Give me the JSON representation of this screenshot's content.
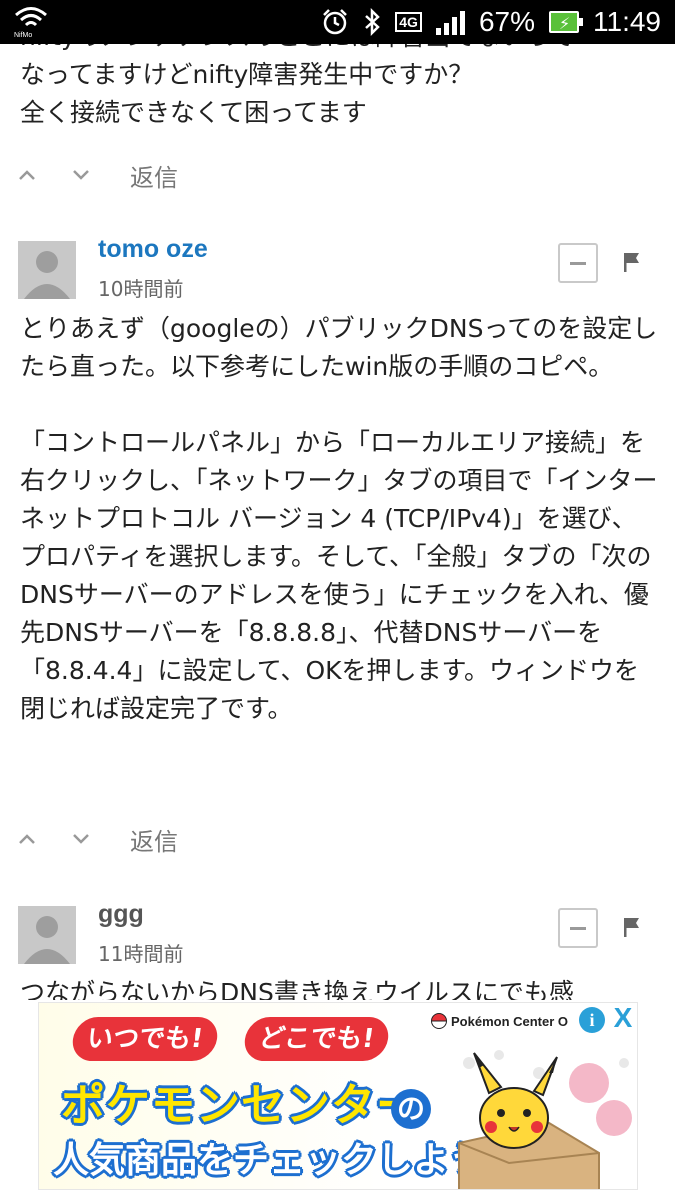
{
  "status_bar": {
    "carrier_logo": "NifMo",
    "icons": [
      "wifi-icon",
      "alarm-icon",
      "bluetooth-icon",
      "4g-icon",
      "signal-icon",
      "battery-charging-icon"
    ],
    "network": "4G",
    "battery": "67%",
    "time": "11:49"
  },
  "thread": {
    "prev_comment": {
      "lines": [
        "niftyのメンテナンスのとこには障害出てないって",
        "なってますけどnifty障害発生中ですか？",
        "全く接続できなくて困ってます"
      ],
      "reply_label": "返信"
    },
    "comments": [
      {
        "author": "tomo oze",
        "time": "10時間前",
        "paragraphs": [
          "とりあえず（googleの）パブリックDNSってのを設定したら直った。以下参考にしたwin版の手順のコピペ。",
          "「コントロールパネル」から「ローカルエリア接続」を右クリックし、「ネットワーク」タブの項目で「インターネットプロトコル バージョン 4 (TCP/IPv4)」を選び、プロパティを選択します。そして、「全般」タブの「次のDNSサーバーのアドレスを使う」にチェックを入れ、優先DNSサーバーを「8.8.8.8」、代替DNSサーバーを「8.8.4.4」に設定して、OKを押します。ウィンドウを閉じれば設定完了です。"
        ],
        "reply_label": "返信"
      },
      {
        "author": "ggg",
        "time": "11時間前",
        "paragraphs": [
          "つながらないからDNS書き換えウイルスにでも感"
        ]
      }
    ]
  },
  "ad": {
    "badge_1": "いつでも!",
    "badge_2": "どこでも!",
    "brand": "Pokémon Center O",
    "title": "ポケモンセンター",
    "connector": "の",
    "subtitle": "人気商品をチェックしよう!",
    "info_label": "i",
    "close_label": "X",
    "colors": {
      "title_fill": "#ffe600",
      "outline_blue": "#1d6fd0",
      "badge_red": "#e8333a"
    }
  }
}
